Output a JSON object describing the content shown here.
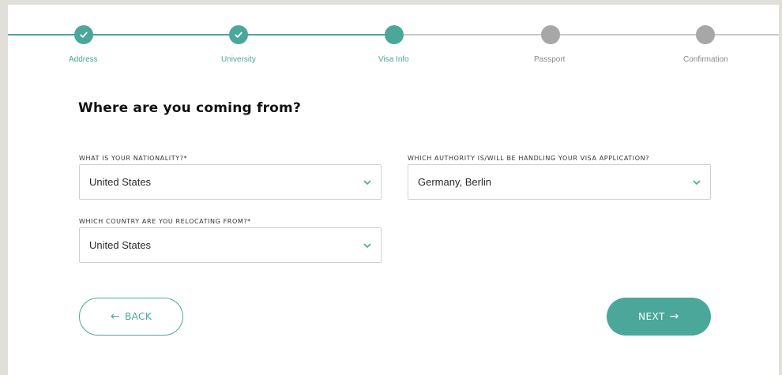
{
  "stepper": {
    "steps": [
      {
        "label": "Address",
        "state": "done"
      },
      {
        "label": "University",
        "state": "done"
      },
      {
        "label": "Visa Info",
        "state": "active"
      },
      {
        "label": "Passport",
        "state": "todo"
      },
      {
        "label": "Confirmation",
        "state": "todo"
      }
    ]
  },
  "form": {
    "title": "Where are you coming from?",
    "nationality": {
      "label": "WHAT IS YOUR NATIONALITY?*",
      "value": "United States"
    },
    "authority": {
      "label": "WHICH AUTHORITY IS/WILL BE HANDLING YOUR VISA APPLICATION?",
      "value": "Germany, Berlin"
    },
    "relocating_from": {
      "label": "WHICH COUNTRY ARE YOU RELOCATING FROM?*",
      "value": "United States"
    }
  },
  "buttons": {
    "back_arrow": "←",
    "back_label": "BACK",
    "next_label": "NEXT",
    "next_arrow": "→"
  },
  "colors": {
    "accent": "#4aa79a",
    "inactive_step": "#a7a7a7",
    "page_background": "#e1dfd9",
    "card_background": "#ffffff"
  },
  "icons": {
    "completed_step": "checkmark-icon",
    "dropdown": "chevron-down-icon"
  }
}
